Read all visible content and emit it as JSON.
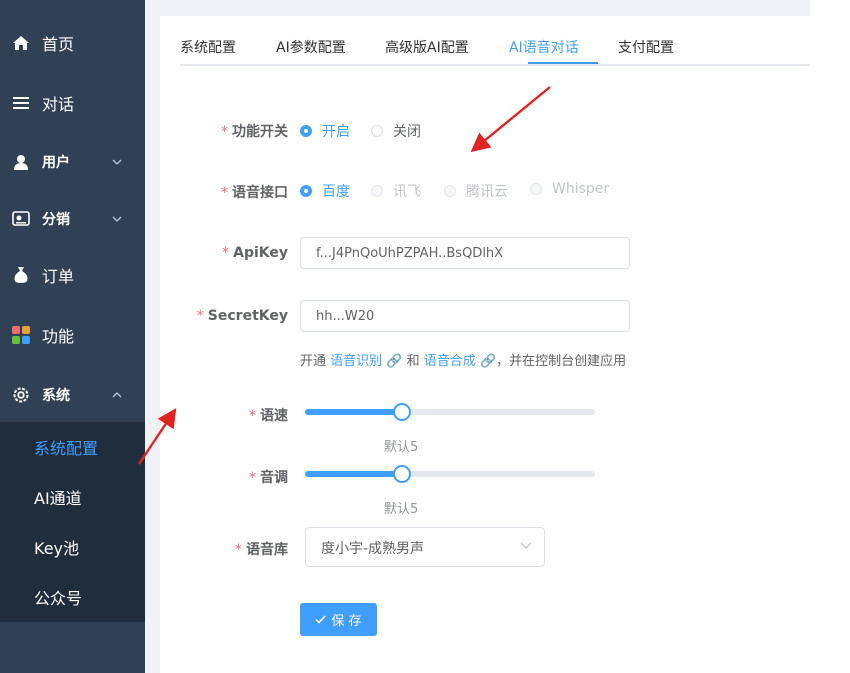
{
  "sidebar": {
    "items": [
      {
        "label": "首页",
        "icon": "home-icon"
      },
      {
        "label": "对话",
        "icon": "list-icon"
      },
      {
        "label": "用户",
        "icon": "user-icon"
      },
      {
        "label": "分销",
        "icon": "distribution-icon"
      },
      {
        "label": "订单",
        "icon": "money-bag-icon"
      },
      {
        "label": "功能",
        "icon": "grid-icon"
      },
      {
        "label": "系统",
        "icon": "gear-icon"
      }
    ],
    "submenu": [
      {
        "label": "系统配置",
        "active": true
      },
      {
        "label": "AI通道"
      },
      {
        "label": "Key池"
      },
      {
        "label": "公众号"
      }
    ]
  },
  "tabs": [
    "系统配置",
    "AI参数配置",
    "高级版AI配置",
    "AI语音对话",
    "支付配置"
  ],
  "active_tab": "AI语音对话",
  "form": {
    "switch": {
      "label": "功能开关",
      "options": [
        "开启",
        "关闭"
      ],
      "selected": "开启"
    },
    "api": {
      "label": "语音接口",
      "options": [
        "百度",
        "讯飞",
        "腾讯云",
        "Whisper"
      ],
      "selected": "百度"
    },
    "apikey": {
      "label": "ApiKey",
      "value": "f...J4PnQoUhPZPAH..BsQDlhX"
    },
    "secretkey": {
      "label": "SecretKey",
      "value": "hh...W20"
    },
    "hint": {
      "prefix": "开通",
      "link1": "语音识别",
      "middle": "和",
      "link2": "语音合成",
      "suffix": "，并在控制台创建应用"
    },
    "speed": {
      "label": "语速",
      "value": 5,
      "min": 0,
      "max": 15,
      "default_text": "默认5"
    },
    "pitch": {
      "label": "音调",
      "value": 5,
      "min": 0,
      "max": 15,
      "default_text": "默认5"
    },
    "voice": {
      "label": "语音库",
      "selected": "度小宇-成熟男声"
    },
    "save_label": "保 存"
  },
  "colors": {
    "primary": "#409eff",
    "sidebar": "#304156",
    "submenu": "#1f2d3d",
    "required": "#f56c6c",
    "arrow": "#e02424"
  }
}
